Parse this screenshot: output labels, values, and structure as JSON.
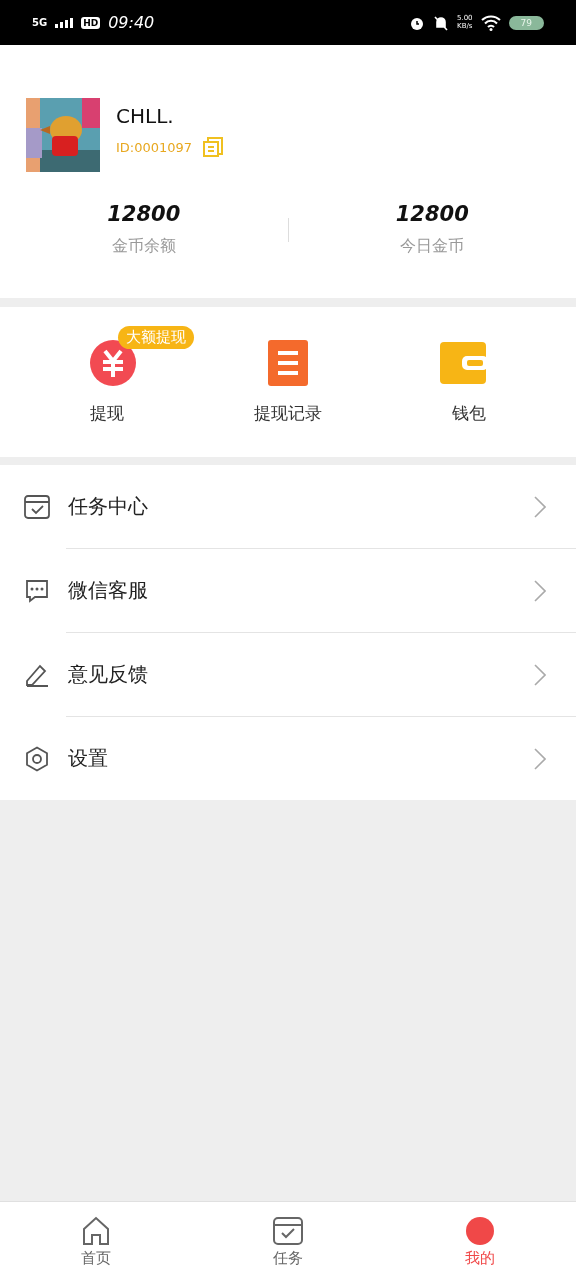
{
  "status_bar": {
    "network": "5G",
    "hd": "HD",
    "time": "09:40",
    "speed": "5.00",
    "speed_unit": "KB/s",
    "battery": "79"
  },
  "profile": {
    "name": "CHLL.",
    "id": "ID:0001097"
  },
  "stats": [
    {
      "value": "12800",
      "label": "金币余额"
    },
    {
      "value": "12800",
      "label": "今日金币"
    }
  ],
  "shortcuts": [
    {
      "kind": "withdraw",
      "label": "提现",
      "badge": "大额提现"
    },
    {
      "kind": "records",
      "label": "提现记录"
    },
    {
      "kind": "wallet",
      "label": "钱包"
    }
  ],
  "menu": [
    {
      "kind": "tasks",
      "label": "任务中心"
    },
    {
      "kind": "wechat",
      "label": "微信客服"
    },
    {
      "kind": "feedback",
      "label": "意见反馈"
    },
    {
      "kind": "settings",
      "label": "设置"
    }
  ],
  "tabs": [
    {
      "kind": "home",
      "label": "首页",
      "selected": false
    },
    {
      "kind": "tasks",
      "label": "任务",
      "selected": false
    },
    {
      "kind": "mine",
      "label": "我的",
      "selected": true
    }
  ]
}
